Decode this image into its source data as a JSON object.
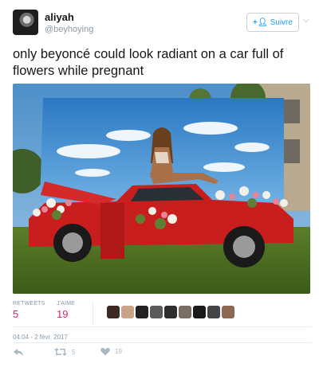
{
  "user": {
    "name": "aliyah",
    "handle": "@beyhoying",
    "avatar": "avatar"
  },
  "follow_button": {
    "label": "Suivre",
    "icon": "add-user-icon"
  },
  "menu": {
    "icon": "chevron-down-icon"
  },
  "tweet": {
    "text": "only beyoncé could look radiant on a car full of flowers while pregnant"
  },
  "photo": {
    "description_icon": "photo"
  },
  "stats": {
    "retweets_label": "RETWEETS",
    "retweets": "5",
    "likes_label": "J'AIME",
    "likes": "19",
    "liker_avatar_count": 9
  },
  "timestamp": "04:04 - 2 févr. 2017",
  "actions": {
    "reply_icon": "reply-icon",
    "retweet_icon": "retweet-icon",
    "retweet_count": "5",
    "like_icon": "heart-icon",
    "like_count": "19"
  },
  "colors": {
    "accent": "#1da1f2",
    "likes": "#e0245e",
    "muted": "#8899a6"
  }
}
